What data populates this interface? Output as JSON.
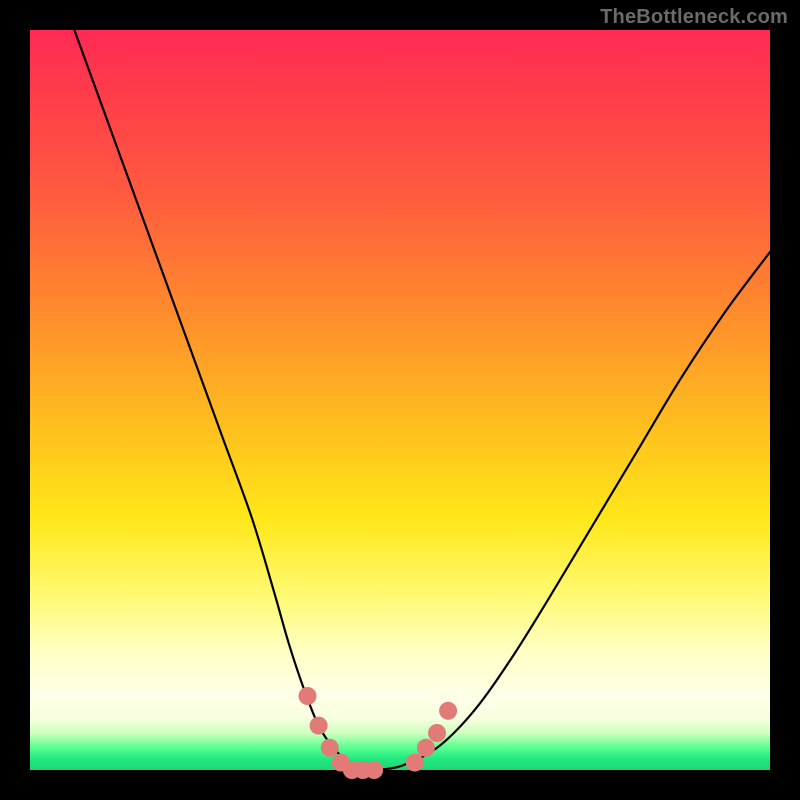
{
  "watermark": "TheBottleneck.com",
  "chart_data": {
    "type": "line",
    "title": "",
    "xlabel": "",
    "ylabel": "",
    "xlim": [
      0,
      100
    ],
    "ylim": [
      0,
      100
    ],
    "grid": false,
    "legend": false,
    "series": [
      {
        "name": "bottleneck-curve",
        "x": [
          6,
          10,
          14,
          18,
          22,
          26,
          30,
          33,
          35,
          37,
          39,
          41,
          43,
          44.5,
          46,
          50,
          55,
          60,
          65,
          70,
          76,
          82,
          88,
          94,
          100
        ],
        "values": [
          100,
          89,
          78,
          67,
          56,
          45,
          34,
          24,
          17,
          11,
          6,
          3,
          1,
          0,
          0,
          0.5,
          3,
          8,
          15,
          23,
          33,
          43,
          53,
          62,
          70
        ],
        "color": "#000000"
      }
    ],
    "markers": {
      "name": "highlight-dots",
      "color": "#e27a78",
      "radius_px": 9,
      "points": [
        {
          "x": 37.5,
          "y": 10
        },
        {
          "x": 39.0,
          "y": 6
        },
        {
          "x": 40.5,
          "y": 3
        },
        {
          "x": 42.0,
          "y": 1
        },
        {
          "x": 43.5,
          "y": 0
        },
        {
          "x": 45.0,
          "y": 0
        },
        {
          "x": 46.5,
          "y": 0
        },
        {
          "x": 52.0,
          "y": 1
        },
        {
          "x": 53.5,
          "y": 3
        },
        {
          "x": 55.0,
          "y": 5
        },
        {
          "x": 56.5,
          "y": 8
        }
      ]
    }
  }
}
